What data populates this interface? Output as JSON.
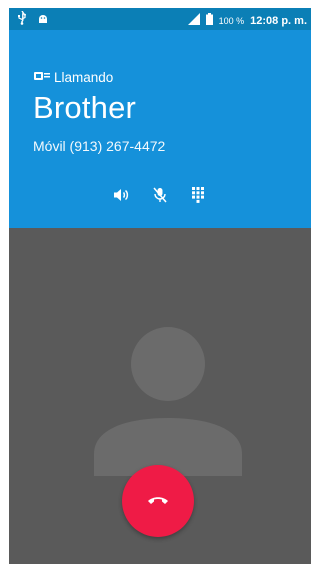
{
  "status_bar": {
    "battery_percent": "100 %",
    "time": "12:08 p. m.",
    "icons": [
      "usb-icon",
      "android-debug-icon",
      "signal-icon",
      "battery-icon"
    ]
  },
  "call": {
    "status_icon": "sim-card-icon",
    "status": "Llamando",
    "contact_name": "Brother",
    "number_line": "Móvil (913) 267-4472"
  },
  "actions": [
    {
      "icon": "speaker-icon"
    },
    {
      "icon": "mute-microphone-icon"
    },
    {
      "icon": "dialpad-icon"
    }
  ],
  "end_call": {
    "icon": "end-call-icon",
    "color": "#ef1b46"
  },
  "colors": {
    "header": "#1591da",
    "status_bar": "#0b7fb6",
    "background": "#5a5a5a",
    "avatar": "#6b6b6b"
  }
}
